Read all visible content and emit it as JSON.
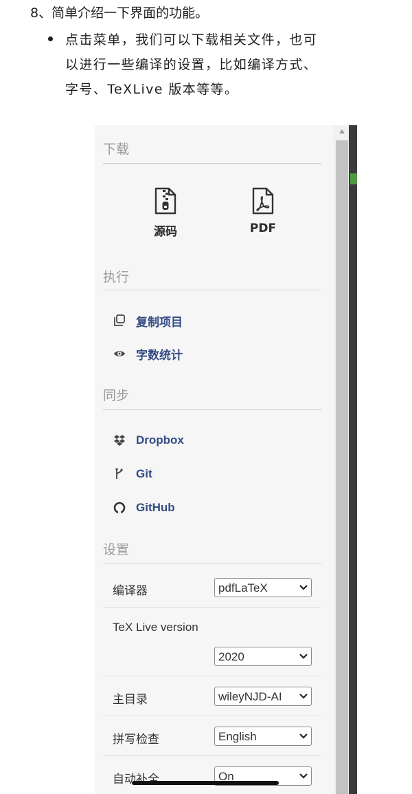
{
  "article": {
    "heading": "8、简单介绍一下界面的功能。",
    "bullet": "点击菜单，我们可以下载相关文件，也可\n以进行一些编译的设置，比如编译方式、\n字号、TeXLive 版本等等。"
  },
  "menu": {
    "download": {
      "title": "下载",
      "items": [
        {
          "label": "源码",
          "icon": "zip-file-icon"
        },
        {
          "label": "PDF",
          "icon": "pdf-file-icon"
        }
      ]
    },
    "actions": {
      "title": "执行",
      "items": [
        {
          "label": "复制项目",
          "icon": "copy-icon"
        },
        {
          "label": "字数统计",
          "icon": "eye-icon"
        }
      ]
    },
    "sync": {
      "title": "同步",
      "items": [
        {
          "label": "Dropbox",
          "icon": "dropbox-icon"
        },
        {
          "label": "Git",
          "icon": "git-icon"
        },
        {
          "label": "GitHub",
          "icon": "github-icon"
        }
      ]
    },
    "settings": {
      "title": "设置",
      "rows": [
        {
          "label": "编译器",
          "value": "pdfLaTeX"
        },
        {
          "label": "TeX Live version",
          "value": "2020"
        },
        {
          "label": "主目录",
          "value": "wileyNJD-AI"
        },
        {
          "label": "拼写检查",
          "value": "English"
        },
        {
          "label": "自动补全",
          "value": "On"
        }
      ]
    }
  },
  "colors": {
    "link": "#344b85",
    "section_title": "#9a9a9a",
    "panel_bg": "#f6f6f6",
    "editor_green": "#4e9a3f"
  }
}
